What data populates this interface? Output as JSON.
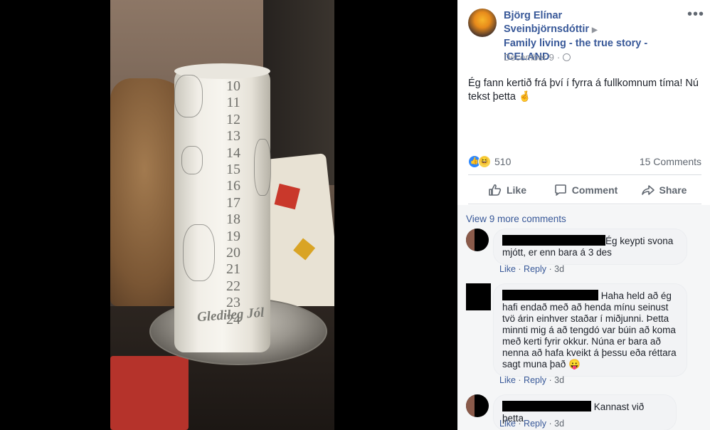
{
  "post": {
    "author": "Björg Elínar Sveinbjörnsdóttir",
    "group": "Family living - the true story - ICELAND",
    "date": "December 9",
    "text": "Ég fann kertið frá því í fyrra á fullkomnum tíma! Nú tekst þetta 🤞",
    "reaction_count": "510",
    "comments_count": "15 Comments",
    "reaction_icons": [
      "like-icon",
      "haha-icon"
    ]
  },
  "photo": {
    "candle_numbers": [
      "10",
      "11",
      "12",
      "13",
      "14",
      "15",
      "16",
      "17",
      "18",
      "19",
      "20",
      "21",
      "22",
      "23",
      "24"
    ],
    "candle_text": "Gledileg Jól"
  },
  "actions": {
    "like": "Like",
    "comment": "Comment",
    "share": "Share"
  },
  "comments": {
    "view_more": "View 9 more comments",
    "items": [
      {
        "text": "Ég keypti svona mjótt, er enn bara á 3 des",
        "like": "Like",
        "reply": "Reply",
        "time": "3d"
      },
      {
        "text": "Haha held að ég hafi endað með að henda mínu seinust tvö árin einhver staðar í miðjunni. Þetta minnti mig á að tengdó var búin að koma með kerti fyrir okkur. Núna er bara að nenna að hafa kveikt á þessu eða réttara sagt muna það 😛",
        "like": "Like",
        "reply": "Reply",
        "time": "3d"
      },
      {
        "text": "Kannast við þetta",
        "like": "Like",
        "reply": "Reply",
        "time": "3d"
      }
    ]
  },
  "colors": {
    "link": "#385898",
    "muted": "#606770",
    "like_blue": "#2d88ff"
  }
}
